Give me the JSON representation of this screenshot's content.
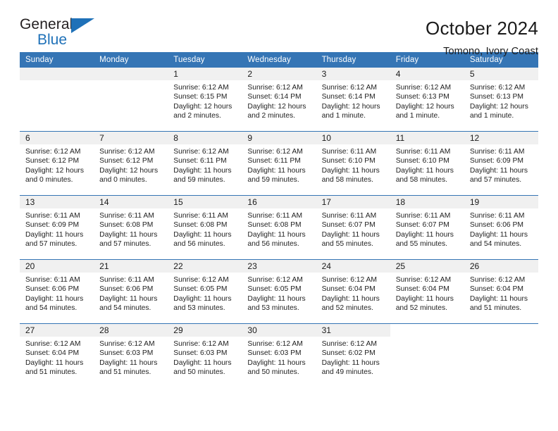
{
  "logo": {
    "word_top": "General",
    "word_bottom": "Blue",
    "accent_color": "#1f71b8",
    "flag_icon": "triangle-flag-icon"
  },
  "header": {
    "month_title": "October 2024",
    "location": "Tomono, Ivory Coast",
    "header_bg": "#3575b5",
    "header_text_color": "#ffffff"
  },
  "weekdays": [
    "Sunday",
    "Monday",
    "Tuesday",
    "Wednesday",
    "Thursday",
    "Friday",
    "Saturday"
  ],
  "labels": {
    "sunrise": "Sunrise:",
    "sunset": "Sunset:",
    "daylight": "Daylight:"
  },
  "weeks": [
    [
      {
        "day": "",
        "empty": true,
        "sunrise": "",
        "sunset": "",
        "daylight_line1": "",
        "daylight_line2": ""
      },
      {
        "day": "",
        "empty": true,
        "sunrise": "",
        "sunset": "",
        "daylight_line1": "",
        "daylight_line2": ""
      },
      {
        "day": "1",
        "sunrise": "Sunrise: 6:12 AM",
        "sunset": "Sunset: 6:15 PM",
        "daylight_line1": "Daylight: 12 hours",
        "daylight_line2": "and 2 minutes."
      },
      {
        "day": "2",
        "sunrise": "Sunrise: 6:12 AM",
        "sunset": "Sunset: 6:14 PM",
        "daylight_line1": "Daylight: 12 hours",
        "daylight_line2": "and 2 minutes."
      },
      {
        "day": "3",
        "sunrise": "Sunrise: 6:12 AM",
        "sunset": "Sunset: 6:14 PM",
        "daylight_line1": "Daylight: 12 hours",
        "daylight_line2": "and 1 minute."
      },
      {
        "day": "4",
        "sunrise": "Sunrise: 6:12 AM",
        "sunset": "Sunset: 6:13 PM",
        "daylight_line1": "Daylight: 12 hours",
        "daylight_line2": "and 1 minute."
      },
      {
        "day": "5",
        "sunrise": "Sunrise: 6:12 AM",
        "sunset": "Sunset: 6:13 PM",
        "daylight_line1": "Daylight: 12 hours",
        "daylight_line2": "and 1 minute."
      }
    ],
    [
      {
        "day": "6",
        "sunrise": "Sunrise: 6:12 AM",
        "sunset": "Sunset: 6:12 PM",
        "daylight_line1": "Daylight: 12 hours",
        "daylight_line2": "and 0 minutes."
      },
      {
        "day": "7",
        "sunrise": "Sunrise: 6:12 AM",
        "sunset": "Sunset: 6:12 PM",
        "daylight_line1": "Daylight: 12 hours",
        "daylight_line2": "and 0 minutes."
      },
      {
        "day": "8",
        "sunrise": "Sunrise: 6:12 AM",
        "sunset": "Sunset: 6:11 PM",
        "daylight_line1": "Daylight: 11 hours",
        "daylight_line2": "and 59 minutes."
      },
      {
        "day": "9",
        "sunrise": "Sunrise: 6:12 AM",
        "sunset": "Sunset: 6:11 PM",
        "daylight_line1": "Daylight: 11 hours",
        "daylight_line2": "and 59 minutes."
      },
      {
        "day": "10",
        "sunrise": "Sunrise: 6:11 AM",
        "sunset": "Sunset: 6:10 PM",
        "daylight_line1": "Daylight: 11 hours",
        "daylight_line2": "and 58 minutes."
      },
      {
        "day": "11",
        "sunrise": "Sunrise: 6:11 AM",
        "sunset": "Sunset: 6:10 PM",
        "daylight_line1": "Daylight: 11 hours",
        "daylight_line2": "and 58 minutes."
      },
      {
        "day": "12",
        "sunrise": "Sunrise: 6:11 AM",
        "sunset": "Sunset: 6:09 PM",
        "daylight_line1": "Daylight: 11 hours",
        "daylight_line2": "and 57 minutes."
      }
    ],
    [
      {
        "day": "13",
        "sunrise": "Sunrise: 6:11 AM",
        "sunset": "Sunset: 6:09 PM",
        "daylight_line1": "Daylight: 11 hours",
        "daylight_line2": "and 57 minutes."
      },
      {
        "day": "14",
        "sunrise": "Sunrise: 6:11 AM",
        "sunset": "Sunset: 6:08 PM",
        "daylight_line1": "Daylight: 11 hours",
        "daylight_line2": "and 57 minutes."
      },
      {
        "day": "15",
        "sunrise": "Sunrise: 6:11 AM",
        "sunset": "Sunset: 6:08 PM",
        "daylight_line1": "Daylight: 11 hours",
        "daylight_line2": "and 56 minutes."
      },
      {
        "day": "16",
        "sunrise": "Sunrise: 6:11 AM",
        "sunset": "Sunset: 6:08 PM",
        "daylight_line1": "Daylight: 11 hours",
        "daylight_line2": "and 56 minutes."
      },
      {
        "day": "17",
        "sunrise": "Sunrise: 6:11 AM",
        "sunset": "Sunset: 6:07 PM",
        "daylight_line1": "Daylight: 11 hours",
        "daylight_line2": "and 55 minutes."
      },
      {
        "day": "18",
        "sunrise": "Sunrise: 6:11 AM",
        "sunset": "Sunset: 6:07 PM",
        "daylight_line1": "Daylight: 11 hours",
        "daylight_line2": "and 55 minutes."
      },
      {
        "day": "19",
        "sunrise": "Sunrise: 6:11 AM",
        "sunset": "Sunset: 6:06 PM",
        "daylight_line1": "Daylight: 11 hours",
        "daylight_line2": "and 54 minutes."
      }
    ],
    [
      {
        "day": "20",
        "sunrise": "Sunrise: 6:11 AM",
        "sunset": "Sunset: 6:06 PM",
        "daylight_line1": "Daylight: 11 hours",
        "daylight_line2": "and 54 minutes."
      },
      {
        "day": "21",
        "sunrise": "Sunrise: 6:11 AM",
        "sunset": "Sunset: 6:06 PM",
        "daylight_line1": "Daylight: 11 hours",
        "daylight_line2": "and 54 minutes."
      },
      {
        "day": "22",
        "sunrise": "Sunrise: 6:12 AM",
        "sunset": "Sunset: 6:05 PM",
        "daylight_line1": "Daylight: 11 hours",
        "daylight_line2": "and 53 minutes."
      },
      {
        "day": "23",
        "sunrise": "Sunrise: 6:12 AM",
        "sunset": "Sunset: 6:05 PM",
        "daylight_line1": "Daylight: 11 hours",
        "daylight_line2": "and 53 minutes."
      },
      {
        "day": "24",
        "sunrise": "Sunrise: 6:12 AM",
        "sunset": "Sunset: 6:04 PM",
        "daylight_line1": "Daylight: 11 hours",
        "daylight_line2": "and 52 minutes."
      },
      {
        "day": "25",
        "sunrise": "Sunrise: 6:12 AM",
        "sunset": "Sunset: 6:04 PM",
        "daylight_line1": "Daylight: 11 hours",
        "daylight_line2": "and 52 minutes."
      },
      {
        "day": "26",
        "sunrise": "Sunrise: 6:12 AM",
        "sunset": "Sunset: 6:04 PM",
        "daylight_line1": "Daylight: 11 hours",
        "daylight_line2": "and 51 minutes."
      }
    ],
    [
      {
        "day": "27",
        "sunrise": "Sunrise: 6:12 AM",
        "sunset": "Sunset: 6:04 PM",
        "daylight_line1": "Daylight: 11 hours",
        "daylight_line2": "and 51 minutes."
      },
      {
        "day": "28",
        "sunrise": "Sunrise: 6:12 AM",
        "sunset": "Sunset: 6:03 PM",
        "daylight_line1": "Daylight: 11 hours",
        "daylight_line2": "and 51 minutes."
      },
      {
        "day": "29",
        "sunrise": "Sunrise: 6:12 AM",
        "sunset": "Sunset: 6:03 PM",
        "daylight_line1": "Daylight: 11 hours",
        "daylight_line2": "and 50 minutes."
      },
      {
        "day": "30",
        "sunrise": "Sunrise: 6:12 AM",
        "sunset": "Sunset: 6:03 PM",
        "daylight_line1": "Daylight: 11 hours",
        "daylight_line2": "and 50 minutes."
      },
      {
        "day": "31",
        "sunrise": "Sunrise: 6:12 AM",
        "sunset": "Sunset: 6:02 PM",
        "daylight_line1": "Daylight: 11 hours",
        "daylight_line2": "and 49 minutes."
      },
      {
        "day": "",
        "blank": true,
        "sunrise": "",
        "sunset": "",
        "daylight_line1": "",
        "daylight_line2": ""
      },
      {
        "day": "",
        "blank": true,
        "sunrise": "",
        "sunset": "",
        "daylight_line1": "",
        "daylight_line2": ""
      }
    ]
  ]
}
